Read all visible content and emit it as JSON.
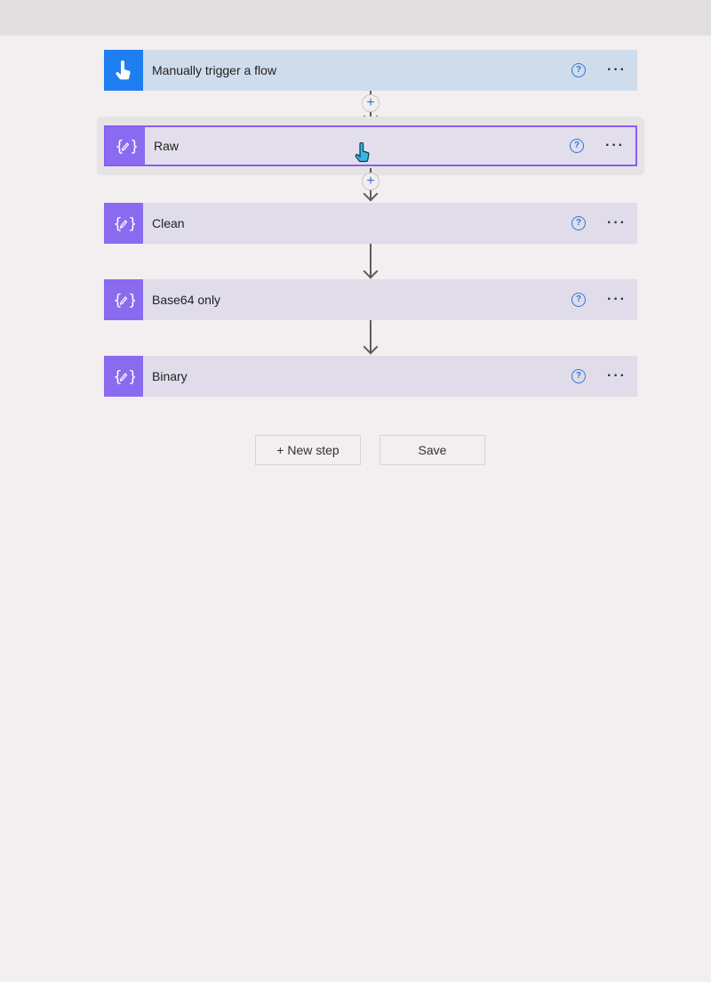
{
  "flow": {
    "steps": [
      {
        "label": "Manually trigger a flow",
        "kind": "trigger",
        "icon": "hand-pointer-icon"
      },
      {
        "label": "Raw",
        "kind": "compose",
        "icon": "compose-braces-icon",
        "selected": true
      },
      {
        "label": "Clean",
        "kind": "compose",
        "icon": "compose-braces-icon"
      },
      {
        "label": "Base64 only",
        "kind": "compose",
        "icon": "compose-braces-icon"
      },
      {
        "label": "Binary",
        "kind": "compose",
        "icon": "compose-braces-icon"
      }
    ],
    "help_glyph": "?",
    "more_glyph": "···",
    "plus_glyph": "+"
  },
  "actions": {
    "new_step_label": "+ New step",
    "save_label": "Save"
  },
  "colors": {
    "trigger_icon_bg": "#1f7ef2",
    "compose_icon_bg": "#8a6bf0",
    "selected_border": "#8a5cf5",
    "help_blue": "#2d78d6"
  }
}
